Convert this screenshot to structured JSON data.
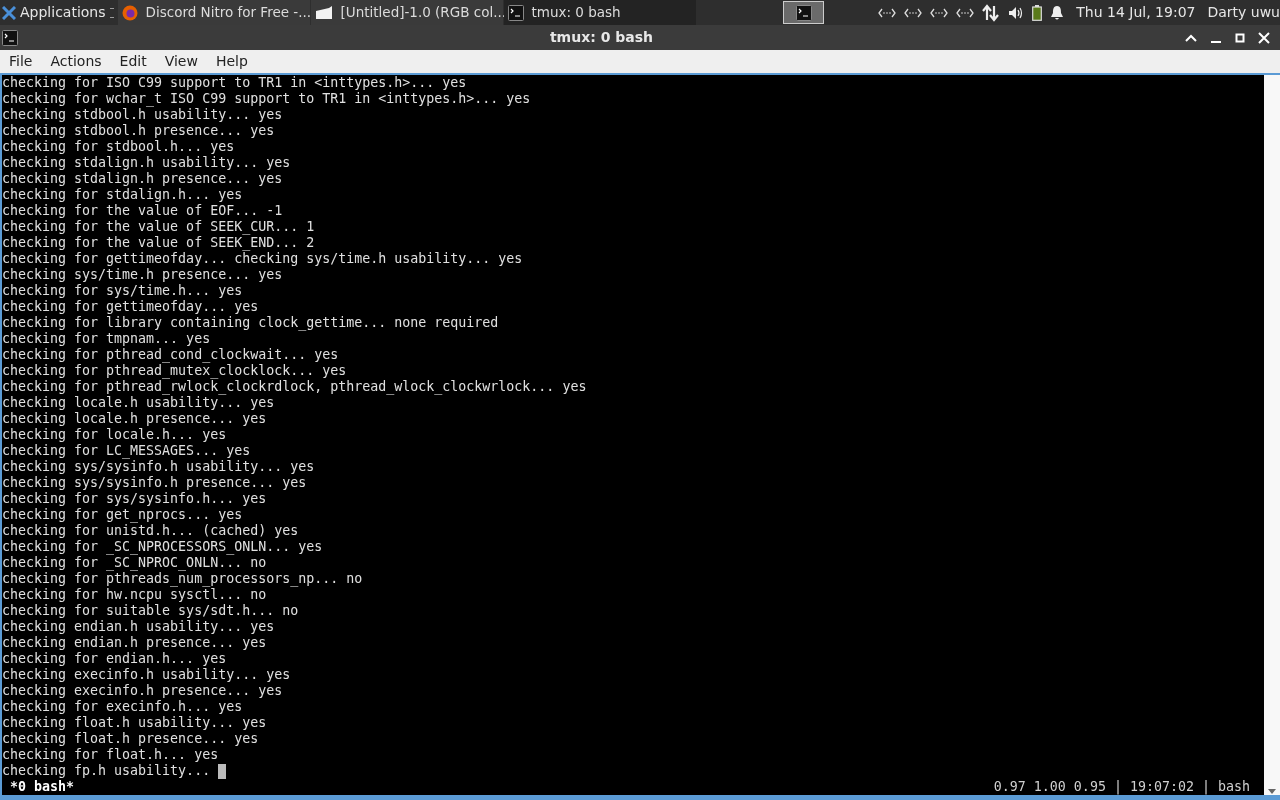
{
  "panel": {
    "apps_menu": "Applications",
    "windows": [
      {
        "title": "Discord Nitro for Free -...",
        "kind": "browser",
        "selected": false
      },
      {
        "title": "[Untitled]-1.0 (RGB col...",
        "kind": "image-editor",
        "selected": false
      },
      {
        "title": "tmux: 0 bash",
        "kind": "terminal",
        "selected": true
      }
    ],
    "clock": "Thu 14 Jul, 19:07",
    "user": "Darty uwu"
  },
  "window": {
    "title": "tmux: 0 bash",
    "menu": [
      "File",
      "Actions",
      "Edit",
      "View",
      "Help"
    ]
  },
  "terminal": {
    "lines": [
      "checking for ISO C99 support to TR1 in <inttypes.h>... yes",
      "checking for wchar_t ISO C99 support to TR1 in <inttypes.h>... yes",
      "checking stdbool.h usability... yes",
      "checking stdbool.h presence... yes",
      "checking for stdbool.h... yes",
      "checking stdalign.h usability... yes",
      "checking stdalign.h presence... yes",
      "checking for stdalign.h... yes",
      "checking for the value of EOF... -1",
      "checking for the value of SEEK_CUR... 1",
      "checking for the value of SEEK_END... 2",
      "checking for gettimeofday... checking sys/time.h usability... yes",
      "checking sys/time.h presence... yes",
      "checking for sys/time.h... yes",
      "checking for gettimeofday... yes",
      "checking for library containing clock_gettime... none required",
      "checking for tmpnam... yes",
      "checking for pthread_cond_clockwait... yes",
      "checking for pthread_mutex_clocklock... yes",
      "checking for pthread_rwlock_clockrdlock, pthread_wlock_clockwrlock... yes",
      "checking locale.h usability... yes",
      "checking locale.h presence... yes",
      "checking for locale.h... yes",
      "checking for LC_MESSAGES... yes",
      "checking sys/sysinfo.h usability... yes",
      "checking sys/sysinfo.h presence... yes",
      "checking for sys/sysinfo.h... yes",
      "checking for get_nprocs... yes",
      "checking for unistd.h... (cached) yes",
      "checking for _SC_NPROCESSORS_ONLN... yes",
      "checking for _SC_NPROC_ONLN... no",
      "checking for pthreads_num_processors_np... no",
      "checking for hw.ncpu sysctl... no",
      "checking for suitable sys/sdt.h... no",
      "checking endian.h usability... yes",
      "checking endian.h presence... yes",
      "checking for endian.h... yes",
      "checking execinfo.h usability... yes",
      "checking execinfo.h presence... yes",
      "checking for execinfo.h... yes",
      "checking float.h usability... yes",
      "checking float.h presence... yes",
      "checking for float.h... yes",
      "checking fp.h usability... "
    ],
    "status_left": "*0 bash*",
    "status_right": "0.97 1.00 0.95 | 19:07:02 | bash"
  }
}
